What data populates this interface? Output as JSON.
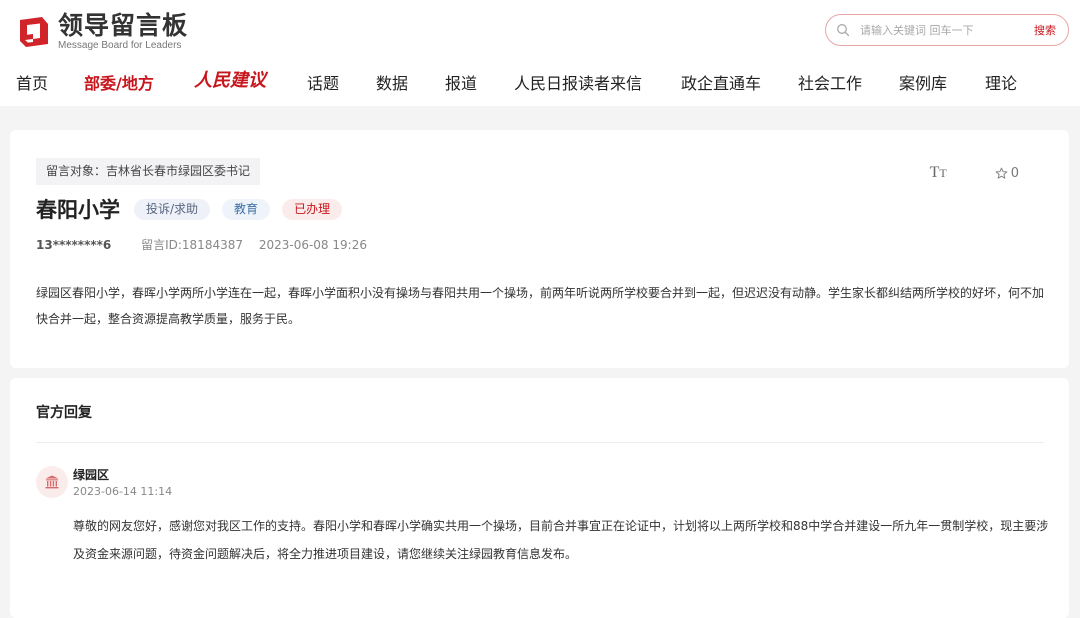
{
  "header": {
    "logo_cn": "领导留言板",
    "logo_en": "Message Board for Leaders",
    "search": {
      "placeholder": "请输入关键词 回车一下",
      "button_label": "搜索"
    }
  },
  "nav": {
    "items": [
      {
        "label": "首页"
      },
      {
        "label": "部委/地方"
      },
      {
        "label": "人民建议"
      },
      {
        "label": "话题"
      },
      {
        "label": "数据"
      },
      {
        "label": "报道"
      },
      {
        "label": "人民日报读者来信"
      },
      {
        "label": "政企直通车"
      },
      {
        "label": "社会工作"
      },
      {
        "label": "案例库"
      },
      {
        "label": "理论"
      }
    ],
    "active": "部委/地方"
  },
  "message": {
    "target": "留言对象：吉林省长春市绿园区委书记",
    "favorite_count": "0",
    "title": "春阳小学",
    "tags": {
      "category": "投诉/求助",
      "field": "教育",
      "status": "已办理"
    },
    "user": "13********6",
    "message_id": "留言ID:18184387",
    "datetime": "2023-06-08 19:26",
    "content": "绿园区春阳小学，春晖小学两所小学连在一起，春晖小学面积小没有操场与春阳共用一个操场，前两年听说两所学校要合并到一起，但迟迟没有动静。学生家长都纠结两所学校的好坏，何不加快合并一起，整合资源提高教学质量，服务于民。"
  },
  "reply": {
    "heading": "官方回复",
    "department": "绿园区",
    "datetime": "2023-06-14 11:14",
    "content": "尊敬的网友您好，感谢您对我区工作的支持。春阳小学和春晖小学确实共用一个操场，目前合并事宜正在论证中，计划将以上两所学校和88中学合并建设一所九年一贯制学校，现主要涉及资金来源问题，待资金问题解决后，将全力推进项目建设，请您继续关注绿园教育信息发布。"
  },
  "colors": {
    "brand_red": "#c8161d",
    "page_bg": "#f4f4f5"
  },
  "icons": [
    "logo-mark-icon",
    "search-icon",
    "font-size-icon",
    "star-icon",
    "government-building-icon"
  ]
}
